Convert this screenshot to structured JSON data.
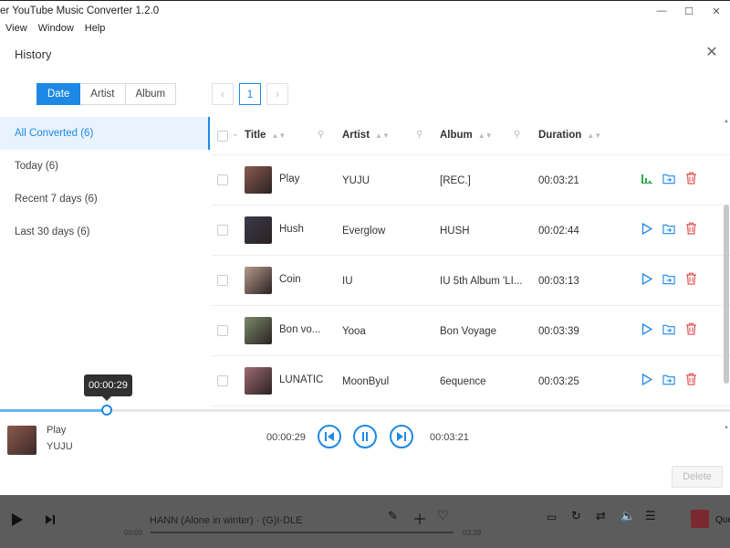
{
  "window": {
    "title": "er YouTube Music Converter 1.2.0",
    "menu": [
      "View",
      "Window",
      "Help"
    ]
  },
  "dialog": {
    "title": "History",
    "filter_tabs": [
      {
        "label": "Date",
        "active": true
      },
      {
        "label": "Artist",
        "active": false
      },
      {
        "label": "Album",
        "active": false
      }
    ],
    "sidebar": [
      {
        "label": "All Converted (6)",
        "active": true
      },
      {
        "label": "Today (6)",
        "active": false
      },
      {
        "label": "Recent 7 days (6)",
        "active": false
      },
      {
        "label": "Last 30 days (6)",
        "active": false
      }
    ],
    "pager": {
      "current": "1"
    },
    "columns": {
      "title": "Title",
      "artist": "Artist",
      "album": "Album",
      "duration": "Duration"
    },
    "rows": [
      {
        "title": "Play",
        "artist": "YUJU",
        "album": "[REC.]",
        "duration": "00:03:21",
        "playing": true,
        "thumb_color": "#8a5a4e"
      },
      {
        "title": "Hush",
        "artist": "Everglow",
        "album": "HUSH",
        "duration": "00:02:44",
        "playing": false,
        "thumb_color": "#3a3a4a"
      },
      {
        "title": "Coin",
        "artist": "IU",
        "album": "IU 5th Album 'LI...",
        "duration": "00:03:13",
        "playing": false,
        "thumb_color": "#b89a8e"
      },
      {
        "title": "Bon vo...",
        "artist": "Yooa",
        "album": "Bon Voyage",
        "duration": "00:03:39",
        "playing": false,
        "thumb_color": "#7a8a6a"
      },
      {
        "title": "LUNATIC",
        "artist": "MoonByul",
        "album": "6equence",
        "duration": "00:03:25",
        "playing": false,
        "thumb_color": "#a06a72"
      }
    ],
    "player": {
      "tooltip": "00:00:29",
      "progress": 0.146,
      "track_title": "Play",
      "track_artist": "YUJU",
      "elapsed": "00:00:29",
      "total": "00:03:21"
    },
    "delete_label": "Delete"
  },
  "bottom_player": {
    "track": "HANN (Alone in winter) · (G)I-DLE",
    "start": "00:00",
    "end": "03:39",
    "queue_label": "Que"
  },
  "colors": {
    "accent": "#1e88e5",
    "delete": "#e05555",
    "playing": "#2fa84f"
  }
}
